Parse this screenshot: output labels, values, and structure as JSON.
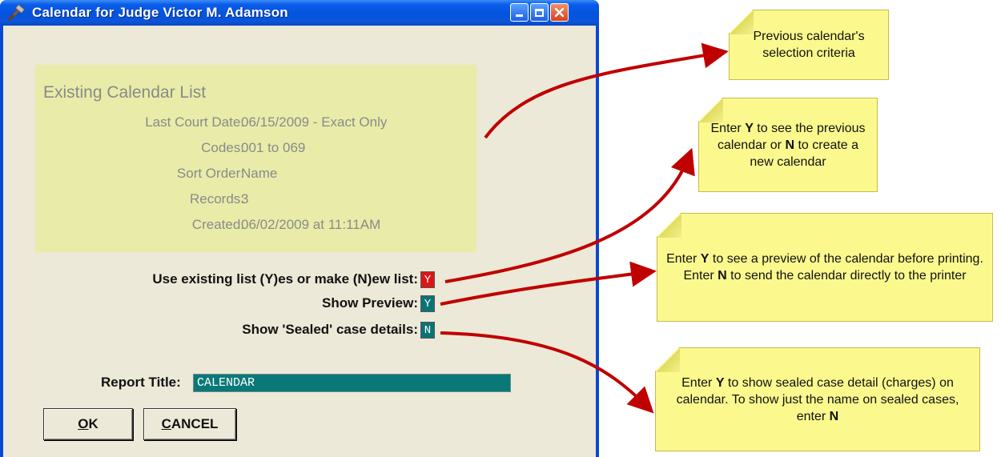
{
  "window": {
    "title": "Calendar for Judge Victor M. Adamson"
  },
  "existing_list": {
    "heading": "Existing Calendar List",
    "rows": [
      {
        "label": "Last Court Date:",
        "value": "06/15/2009 - Exact Only"
      },
      {
        "label": "Codes:",
        "value": "001 to 069"
      },
      {
        "label": "Sort Order:",
        "value": "Name"
      },
      {
        "label": "Records:",
        "value": "3"
      },
      {
        "label": "Created:",
        "value": "06/02/2009 at 11:11AM"
      }
    ]
  },
  "options": [
    {
      "label": "Use existing list (Y)es or make (N)ew list:",
      "value": "Y",
      "color": "#d81818"
    },
    {
      "label": "Show Preview:",
      "value": "Y",
      "color": "#0a7474"
    },
    {
      "label": "Show 'Sealed' case details:",
      "value": "N",
      "color": "#0a7474"
    }
  ],
  "report": {
    "label": "Report Title:",
    "value": "CALENDAR"
  },
  "buttons": {
    "ok": {
      "underline": "O",
      "rest": "K"
    },
    "cancel": {
      "underline": "C",
      "rest": "ANCEL"
    }
  },
  "callouts": [
    {
      "text": "Previous calendar's selection criteria"
    },
    {
      "pre": "Enter ",
      "k1": "Y",
      "mid": "  to see the previous calendar or ",
      "k2": "N",
      "post": "  to create a new calendar"
    },
    {
      "pre": "Enter ",
      "k1": "Y",
      "mid": " to see a preview of the calendar before printing.  Enter ",
      "k2": "N",
      "post": " to send the calendar directly to the printer"
    },
    {
      "pre": "Enter ",
      "k1": "Y",
      "mid": " to show sealed case detail (charges) on calendar.  To show just the name on sealed cases, enter ",
      "k2": "N",
      "post": ""
    }
  ],
  "colors": {
    "titlebar": "#0453df",
    "panel": "#e8eca8",
    "note": "#fbf98e",
    "arrow": "#c00000",
    "input": "#0b7878"
  }
}
